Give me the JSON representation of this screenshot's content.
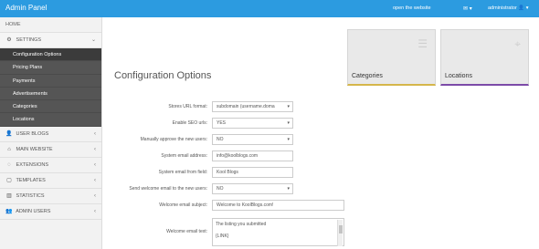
{
  "app": {
    "brand": "Admin Panel",
    "top_link": "open the website",
    "mail_icon": "envelope-icon",
    "user_label": "administrator",
    "user_icon": "user-icon"
  },
  "sidebar": {
    "home": "HOME",
    "settings": "SETTINGS",
    "sub_items": [
      "Configuration Options",
      "Pricing Plans",
      "Payments",
      "Advertisements",
      "Categories",
      "Locations"
    ],
    "items": [
      "USER BLOGS",
      "MAIN WEBSITE",
      "EXTENSIONS",
      "TEMPLATES",
      "STATISTICS",
      "ADMIN USERS"
    ]
  },
  "cards": {
    "categories": "Categories",
    "locations": "Locations"
  },
  "page": {
    "title": "Configuration Options"
  },
  "form": {
    "stores_url_format_label": "Stores URL format:",
    "stores_url_format_value": "subdomain (username.doma",
    "enable_seo_label": "Enable SEO urls:",
    "enable_seo_value": "YES",
    "manual_approve_label": "Manually approve the new users:",
    "manual_approve_value": "NO",
    "system_email_label": "System email address:",
    "system_email_value": "info@koolblogs.com",
    "system_email_from_label": "System email from field:",
    "system_email_from_value": "Kool Blogs",
    "send_welcome_label": "Send welcome email to the new users:",
    "send_welcome_value": "NO",
    "welcome_subject_label": "Welcome email subject:",
    "welcome_subject_value": "Welcome to KoolBlogs.com!",
    "welcome_text_label": "Welcome email text:",
    "welcome_text_line1": "The listing you submitted",
    "welcome_text_line2": "{LINK}"
  }
}
